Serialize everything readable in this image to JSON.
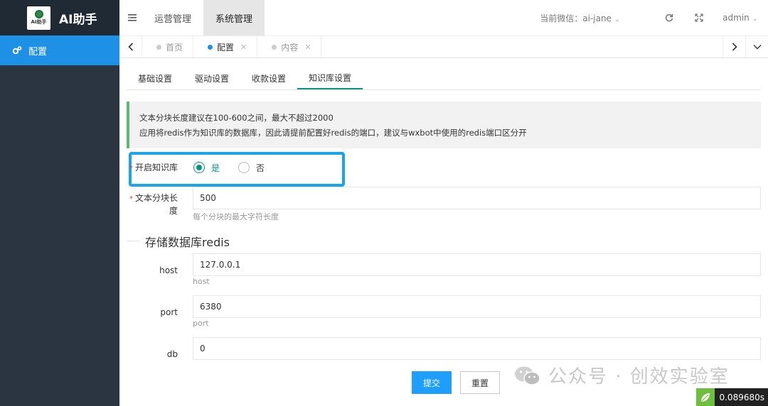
{
  "brand": {
    "logo_text": "AI助手",
    "name": "AI助手"
  },
  "sidebar": {
    "items": [
      {
        "label": "配置",
        "icon": "gears-icon",
        "active": true
      }
    ]
  },
  "header": {
    "top_tabs": [
      {
        "label": "运营管理"
      },
      {
        "label": "系统管理",
        "active": true
      }
    ],
    "wechat_label": "当前微信：ai-jane",
    "user": "admin"
  },
  "page_tabs": [
    {
      "label": "首页",
      "closable": false
    },
    {
      "label": "配置",
      "closable": true,
      "active": true
    },
    {
      "label": "内容",
      "closable": true
    }
  ],
  "sub_tabs": [
    {
      "label": "基础设置"
    },
    {
      "label": "驱动设置"
    },
    {
      "label": "收款设置"
    },
    {
      "label": "知识库设置",
      "active": true
    }
  ],
  "notice": {
    "line1": "文本分块长度建议在100-600之间，最大不超过2000",
    "line2": "应用将redis作为知识库的数据库，因此请提前配置好redis的端口，建议与wxbot中使用的redis端口区分开"
  },
  "form": {
    "enable_kb": {
      "label": "开启知识库",
      "options": [
        "是",
        "否"
      ],
      "selected": "是"
    },
    "chunk": {
      "label_line1": "文本分块长",
      "label_line2": "度",
      "value": "500",
      "hint": "每个分块的最大字符长度"
    },
    "section_title": "存储数据库redis",
    "host": {
      "label": "host",
      "value": "127.0.0.1",
      "hint": "host"
    },
    "port": {
      "label": "port",
      "value": "6380",
      "hint": "port"
    },
    "db": {
      "label": "db",
      "value": "0"
    }
  },
  "buttons": {
    "submit": "提交",
    "reset": "重置"
  },
  "watermark": "公众号 · 创效实验室",
  "timer": "0.089680s",
  "colors": {
    "sidebar": "#2a3541",
    "active_blue": "#1e90e6",
    "teal": "#009688",
    "highlight": "#17a6e8"
  }
}
